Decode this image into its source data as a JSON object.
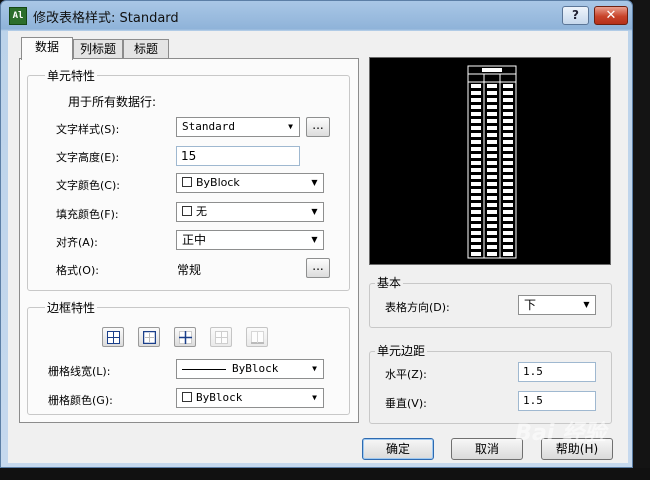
{
  "window": {
    "title": "修改表格样式: Standard",
    "help_label": "?",
    "close_label": "✕",
    "app_icon": "Al"
  },
  "tabs": [
    {
      "label": "数据",
      "active": true
    },
    {
      "label": "列标题",
      "active": false
    },
    {
      "label": "标题",
      "active": false
    }
  ],
  "cell_props": {
    "group_title": "单元特性",
    "applies_to": "用于所有数据行:",
    "text_style": {
      "label": "文字样式(S):",
      "value": "Standard",
      "ellipsis": "..."
    },
    "text_height": {
      "label": "文字高度(E):",
      "value": "15"
    },
    "text_color": {
      "label": "文字颜色(C):",
      "value": "ByBlock"
    },
    "fill_color": {
      "label": "填充颜色(F):",
      "value": "无"
    },
    "alignment": {
      "label": "对齐(A):",
      "value": "正中"
    },
    "format": {
      "label": "格式(O):",
      "value": "常规",
      "ellipsis": "..."
    }
  },
  "border_props": {
    "group_title": "边框特性",
    "buttons": [
      {
        "icon": "all-borders-icon",
        "enabled": true
      },
      {
        "icon": "outside-borders-icon",
        "enabled": true
      },
      {
        "icon": "inside-borders-icon",
        "enabled": true
      },
      {
        "icon": "no-borders-icon",
        "enabled": false
      },
      {
        "icon": "bottom-border-icon",
        "enabled": false
      }
    ],
    "line_weight": {
      "label": "栅格线宽(L):",
      "value": "ByBlock"
    },
    "grid_color": {
      "label": "栅格颜色(G):",
      "value": "ByBlock"
    }
  },
  "basic": {
    "group_title": "基本",
    "direction": {
      "label": "表格方向(D):",
      "value": "下"
    }
  },
  "cell_margins": {
    "group_title": "单元边距",
    "horizontal": {
      "label": "水平(Z):",
      "value": "1.5"
    },
    "vertical": {
      "label": "垂直(V):",
      "value": "1.5"
    }
  },
  "footer": {
    "ok": "确定",
    "cancel": "取消",
    "help": "帮助(H)"
  },
  "watermark": "Bai 经验",
  "colors": {
    "annotation_red": "#d9262a",
    "title_bar": "#a9c7e6",
    "preview_bg": "#000000"
  }
}
